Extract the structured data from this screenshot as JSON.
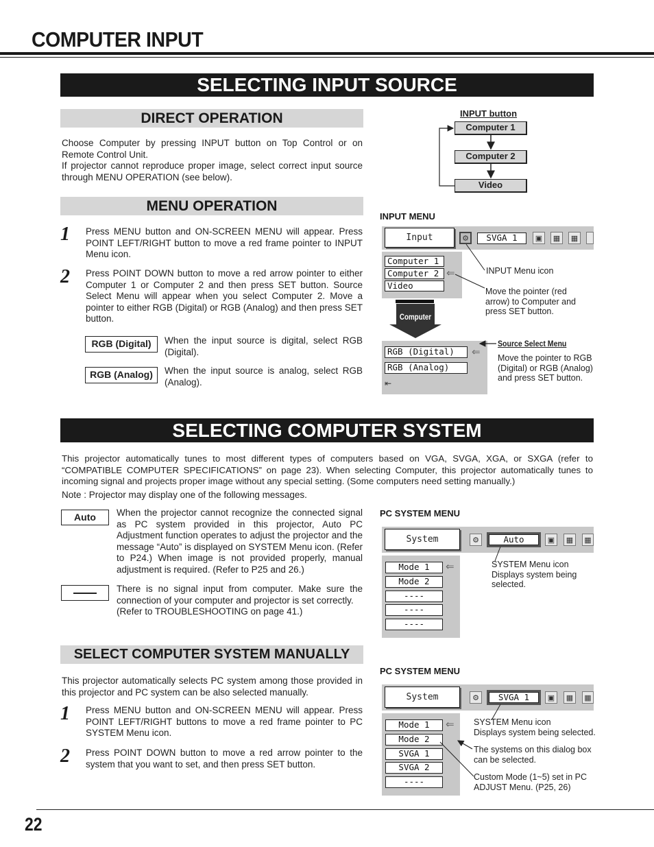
{
  "page": {
    "title": "COMPUTER INPUT",
    "page_number": "22"
  },
  "input_source": {
    "heading": "SELECTING INPUT SOURCE",
    "direct": {
      "heading": "DIRECT OPERATION",
      "text1": "Choose Computer by pressing INPUT button on Top Control or on Remote Control Unit.",
      "text2": "If projector cannot reproduce proper image, select correct input source through MENU OPERATION (see below)."
    },
    "input_button_diagram": {
      "title": "INPUT button",
      "items": [
        "Computer 1",
        "Computer 2",
        "Video"
      ]
    },
    "menu_op": {
      "heading": "MENU OPERATION",
      "steps": [
        {
          "num": "1",
          "text": "Press MENU button and ON-SCREEN MENU will appear.  Press POINT LEFT/RIGHT button to move a red frame pointer to INPUT Menu icon."
        },
        {
          "num": "2",
          "text": "Press POINT DOWN button to move a red arrow pointer to either Computer 1 or Computer 2 and then press SET button. Source Select Menu will appear when you select Computer 2. Move a pointer to either RGB (Digital) or RGB (Analog) and then press SET button."
        }
      ],
      "options": [
        {
          "label": "RGB (Digital)",
          "text": "When the input source is digital, select RGB (Digital)."
        },
        {
          "label": "RGB (Analog)",
          "text": "When the input source is analog, select RGB (Analog)."
        }
      ]
    },
    "input_menu": {
      "title": "INPUT MENU",
      "main_label": "Input",
      "current_system": "SVGA 1",
      "items": [
        "Computer 1",
        "Computer 2",
        "Video"
      ],
      "arrow_label": "Computer",
      "callout_icon": "INPUT Menu icon",
      "callout_pointer": "Move the pointer (red arrow) to Computer and press SET button.",
      "source_select": {
        "title": "Source Select Menu",
        "items": [
          "RGB (Digital)",
          "RGB (Analog)"
        ],
        "text": "Move the pointer to RGB (Digital) or RGB (Analog) and press SET button."
      }
    }
  },
  "computer_system": {
    "heading": "SELECTING COMPUTER SYSTEM",
    "intro": "This projector automatically tunes to most different types of computers based on VGA, SVGA, XGA, or SXGA (refer to “COMPATIBLE COMPUTER SPECIFICATIONS” on page 23).  When selecting Computer, this projector automatically tunes to incoming signal and projects proper image without any special setting.  (Some computers need setting manually.)",
    "note": "Note : Projector may display one of the following messages.",
    "messages": [
      {
        "label": "Auto",
        "text": "When the projector cannot recognize the connected signal as PC system provided in this projector, Auto PC Adjustment function operates to adjust the projector and the message “Auto” is displayed on SYSTEM Menu icon. (Refer to P24.)  When image is not provided properly, manual adjustment is required.  (Refer to P25 and 26.)"
      },
      {
        "label": "-----",
        "text": "There is no signal input from computer.  Make sure the connection of your computer and projector is set correctly.",
        "text2": "(Refer to TROUBLESHOOTING on page 41.)"
      }
    ],
    "pc_menu_1": {
      "title": "PC SYSTEM MENU",
      "main_label": "System",
      "current_system": "Auto",
      "items": [
        "Mode 1",
        "Mode 2",
        "----",
        "----",
        "----"
      ],
      "callout": "SYSTEM Menu icon Displays system being selected."
    },
    "manual": {
      "heading": "SELECT COMPUTER SYSTEM MANUALLY",
      "intro": "This projector automatically selects PC system among those provided in this projector and PC system can be also selected manually.",
      "steps": [
        {
          "num": "1",
          "text": "Press MENU button and ON-SCREEN MENU will appear.  Press POINT LEFT/RIGHT buttons to move a red frame pointer to PC SYSTEM Menu icon."
        },
        {
          "num": "2",
          "text": "Press POINT DOWN button to move a red arrow pointer to the system that you want to set, and then press SET button."
        }
      ]
    },
    "pc_menu_2": {
      "title": "PC SYSTEM MENU",
      "main_label": "System",
      "current_system": "SVGA 1",
      "items": [
        "Mode 1",
        "Mode 2",
        "SVGA 1",
        "SVGA 2",
        "----"
      ],
      "callout_icon_1": "SYSTEM Menu icon",
      "callout_icon_2": "Displays system being selected.",
      "callout_systems": "The systems on this dialog box can be selected.",
      "callout_custom": "Custom Mode (1~5) set in PC ADJUST Menu.  (P25, 26)"
    }
  }
}
